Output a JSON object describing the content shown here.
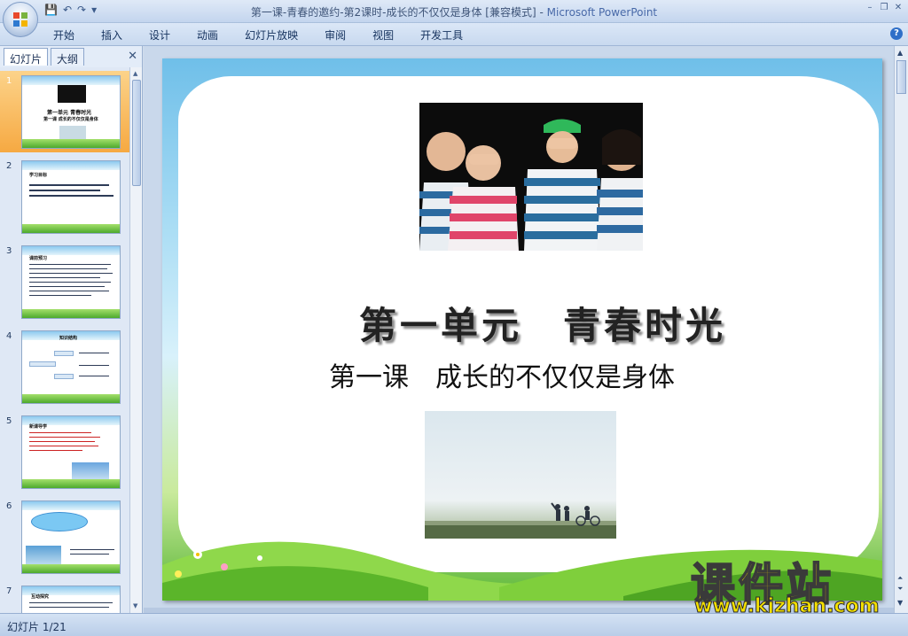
{
  "window": {
    "title": "第一课-青春的邀约-第2课时-成长的不仅仅是身体 [兼容模式] - ",
    "app_name": "Microsoft PowerPoint"
  },
  "quick_access": {
    "save": "💾",
    "undo": "↶",
    "redo": "↷",
    "more": "▾"
  },
  "window_controls": {
    "minimize": "–",
    "restore": "❐",
    "close": "✕"
  },
  "ribbon": {
    "tabs": [
      "开始",
      "插入",
      "设计",
      "动画",
      "幻灯片放映",
      "审阅",
      "视图",
      "开发工具"
    ],
    "help": "?"
  },
  "panel": {
    "tab_slides": "幻灯片",
    "tab_outline": "大纲",
    "close": "✕",
    "thumbnails": [
      {
        "num": "1",
        "title": "第一单元  青春时光",
        "subtitle": "第一课 成长的不仅仅是身体"
      },
      {
        "num": "2",
        "title": "学习目标"
      },
      {
        "num": "3",
        "title": "课前预习"
      },
      {
        "num": "4",
        "title": "知识结构"
      },
      {
        "num": "5",
        "title": "新课导学"
      },
      {
        "num": "6",
        "title": ""
      },
      {
        "num": "7",
        "title": "互动探究"
      }
    ]
  },
  "slide": {
    "title_part1": "第一单元",
    "title_part2": "青春时光",
    "subtitle_part1": "第一课",
    "subtitle_part2": "成长的不仅仅是身体"
  },
  "watermark": {
    "big": "课件站",
    "url": "www.kjzhan.com"
  },
  "status": {
    "slide_counter": "幻灯片 1/21"
  },
  "colors": {
    "accent": "#f6a942",
    "ribbon": "#c8d9ef",
    "watermark": "#f4e000"
  }
}
